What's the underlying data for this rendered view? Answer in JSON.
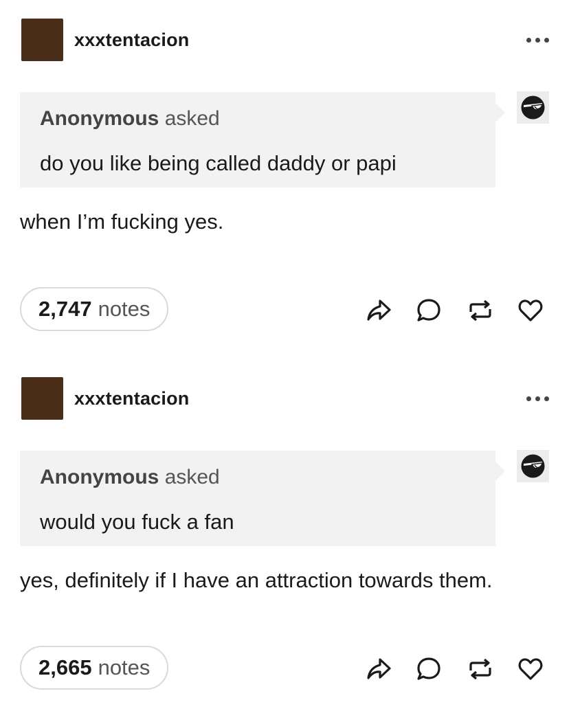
{
  "colors": {
    "avatar": "#4a2e1a",
    "ask_background": "#f2f2f2",
    "icon": "#1a1a1a"
  },
  "icons": {
    "more": "more-horizontal-icon",
    "asker_avatar": "sunglasses-face-icon",
    "share": "share-arrow-icon",
    "reply": "speech-bubble-icon",
    "reblog": "reblog-arrows-icon",
    "like": "heart-icon"
  },
  "posts": [
    {
      "username": "xxxtentacion",
      "asker": "Anonymous",
      "asked_word": "asked",
      "question": "do you like being called daddy or papi",
      "answer": "when I’m fucking yes.",
      "notes_count": "2,747",
      "notes_word": "notes"
    },
    {
      "username": "xxxtentacion",
      "asker": "Anonymous",
      "asked_word": "asked",
      "question": "would you fuck a fan",
      "answer": "yes, definitely if I have an attraction towards them.",
      "notes_count": "2,665",
      "notes_word": "notes"
    }
  ]
}
